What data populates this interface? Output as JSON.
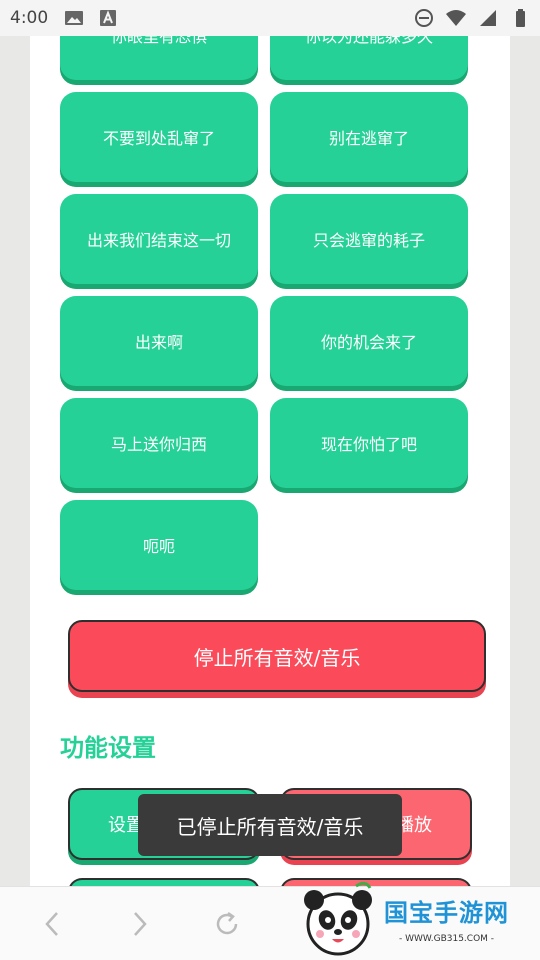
{
  "status_bar": {
    "time": "4:00",
    "left_icons": [
      "image-icon",
      "text-a-icon"
    ],
    "right_icons": [
      "dnd-icon",
      "wifi-icon",
      "signal-icon",
      "battery-icon"
    ]
  },
  "sound_buttons": [
    {
      "label": "你眼里有恐惧"
    },
    {
      "label": "你以为还能躲多久"
    },
    {
      "label": "不要到处乱窜了"
    },
    {
      "label": "别在逃窜了"
    },
    {
      "label": "出来我们结束这一切"
    },
    {
      "label": "只会逃窜的耗子"
    },
    {
      "label": "出来啊"
    },
    {
      "label": "你的机会来了"
    },
    {
      "label": "马上送你归西"
    },
    {
      "label": "现在你怕了吧"
    },
    {
      "label": "呃呃"
    }
  ],
  "stop_button": {
    "label": "停止所有音效/音乐"
  },
  "settings": {
    "title": "功能设置",
    "buttons": [
      {
        "label": "设置"
      },
      {
        "label": "播放"
      }
    ]
  },
  "toast": {
    "text": "已停止所有音效/音乐"
  },
  "toolbar": {
    "icons": [
      "back-icon",
      "forward-icon",
      "refresh-icon"
    ]
  },
  "watermark": {
    "title": "国宝手游网",
    "url": "- WWW.GB315.COM -"
  },
  "colors": {
    "green": "#25d196",
    "green_shadow": "#19a772",
    "red": "#fb4b5a",
    "toast_bg": "#3a3a3a",
    "watermark_blue": "#1f93d6"
  }
}
